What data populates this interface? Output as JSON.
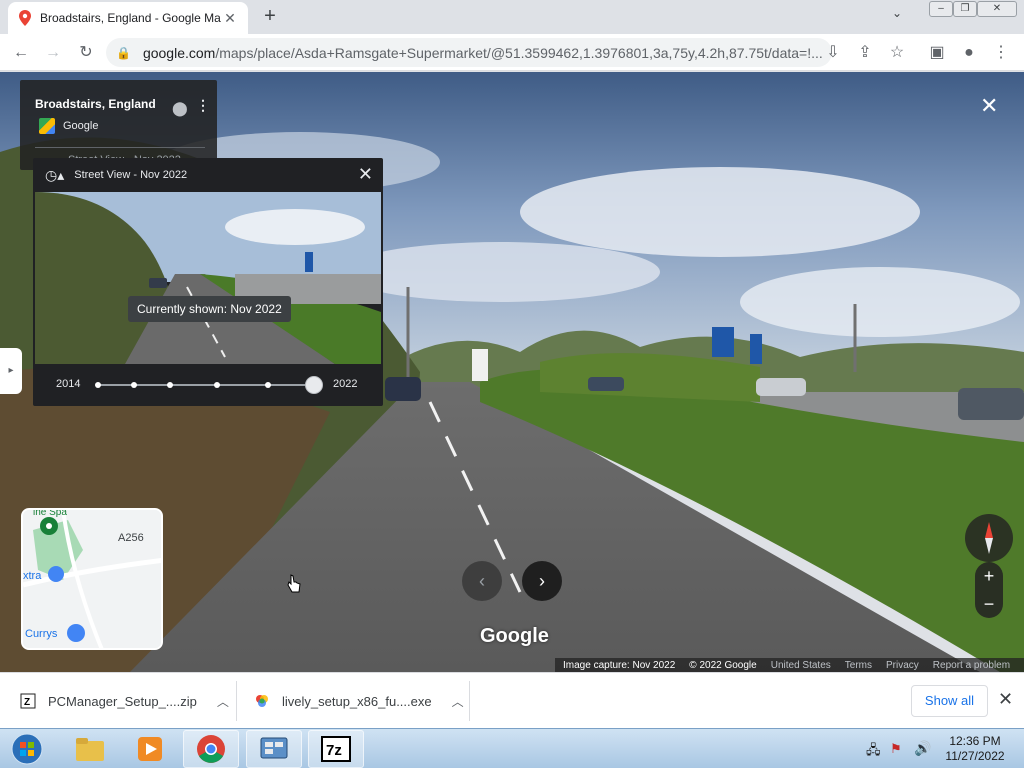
{
  "browser": {
    "tab_title": "Broadstairs, England - Google Ma",
    "new_tab": "+",
    "url_host": "google.com",
    "url_path": "/maps/place/Asda+Ramsgate+Supermarket/@51.3599462,1.3976801,3a,75y,4.2h,87.75t/data=!..."
  },
  "place_card": {
    "name": "Broadstairs, England",
    "provider": "Google",
    "date": "Street View - Nov 2022"
  },
  "time_travel": {
    "title": "Street View - Nov 2022",
    "tooltip": "Currently shown: Nov 2022",
    "start_year": "2014",
    "end_year": "2022"
  },
  "minimap": {
    "road_label": "A256",
    "poi_top": "ine Spa",
    "poi_middle": "xtra",
    "poi_bottom": "Currys"
  },
  "streetview": {
    "watermark": "Google",
    "attribution": {
      "capture": "Image capture: Nov 2022",
      "copyright": "© 2022 Google",
      "country": "United States",
      "terms": "Terms",
      "privacy": "Privacy",
      "report": "Report a problem"
    }
  },
  "downloads": {
    "items": [
      {
        "name": "PCManager_Setup_....zip"
      },
      {
        "name": "lively_setup_x86_fu....exe"
      }
    ],
    "show_all": "Show all"
  },
  "taskbar": {
    "time": "12:36 PM",
    "date": "11/27/2022"
  }
}
